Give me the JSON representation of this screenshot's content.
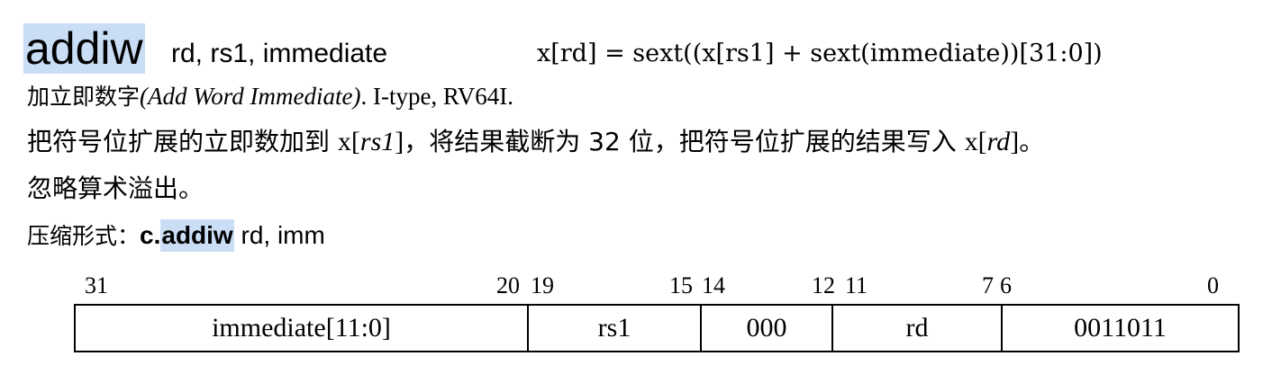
{
  "instruction": {
    "mnemonic": "addiw",
    "operands": "rd, rs1, immediate",
    "semantics": "x[rd] = sext((x[rs1] + sext(immediate))[31:0])"
  },
  "name_line": {
    "cn_name": "加立即数字",
    "en_name": "(Add Word Immediate)",
    "sep": ".",
    "type_info": " I-type, RV64I."
  },
  "description": {
    "p1": "把符号位扩展的立即数加到 ",
    "x1": "x[",
    "rs1": "rs1",
    "x1_close": "]",
    "p2": "，将结果截断为 ",
    "num32": "32",
    "p3": " 位，把符号位扩展的结果写入 ",
    "x2": "x[",
    "rd": "rd",
    "x2_close": "]",
    "p4": "。",
    "line2": "忽略算术溢出。"
  },
  "compressed": {
    "label": "压缩形式：",
    "prefix": "c.",
    "mnemonic": "addiw",
    "operands": " rd, imm"
  },
  "encoding": {
    "bit_labels": [
      "31",
      "20",
      "19",
      "15",
      "14",
      "12",
      "11",
      "7",
      "6",
      "0"
    ],
    "fields": [
      "immediate[11:0]",
      "rs1",
      "000",
      "rd",
      "0011011"
    ]
  },
  "colors": {
    "highlight": "#c9ddf5"
  }
}
